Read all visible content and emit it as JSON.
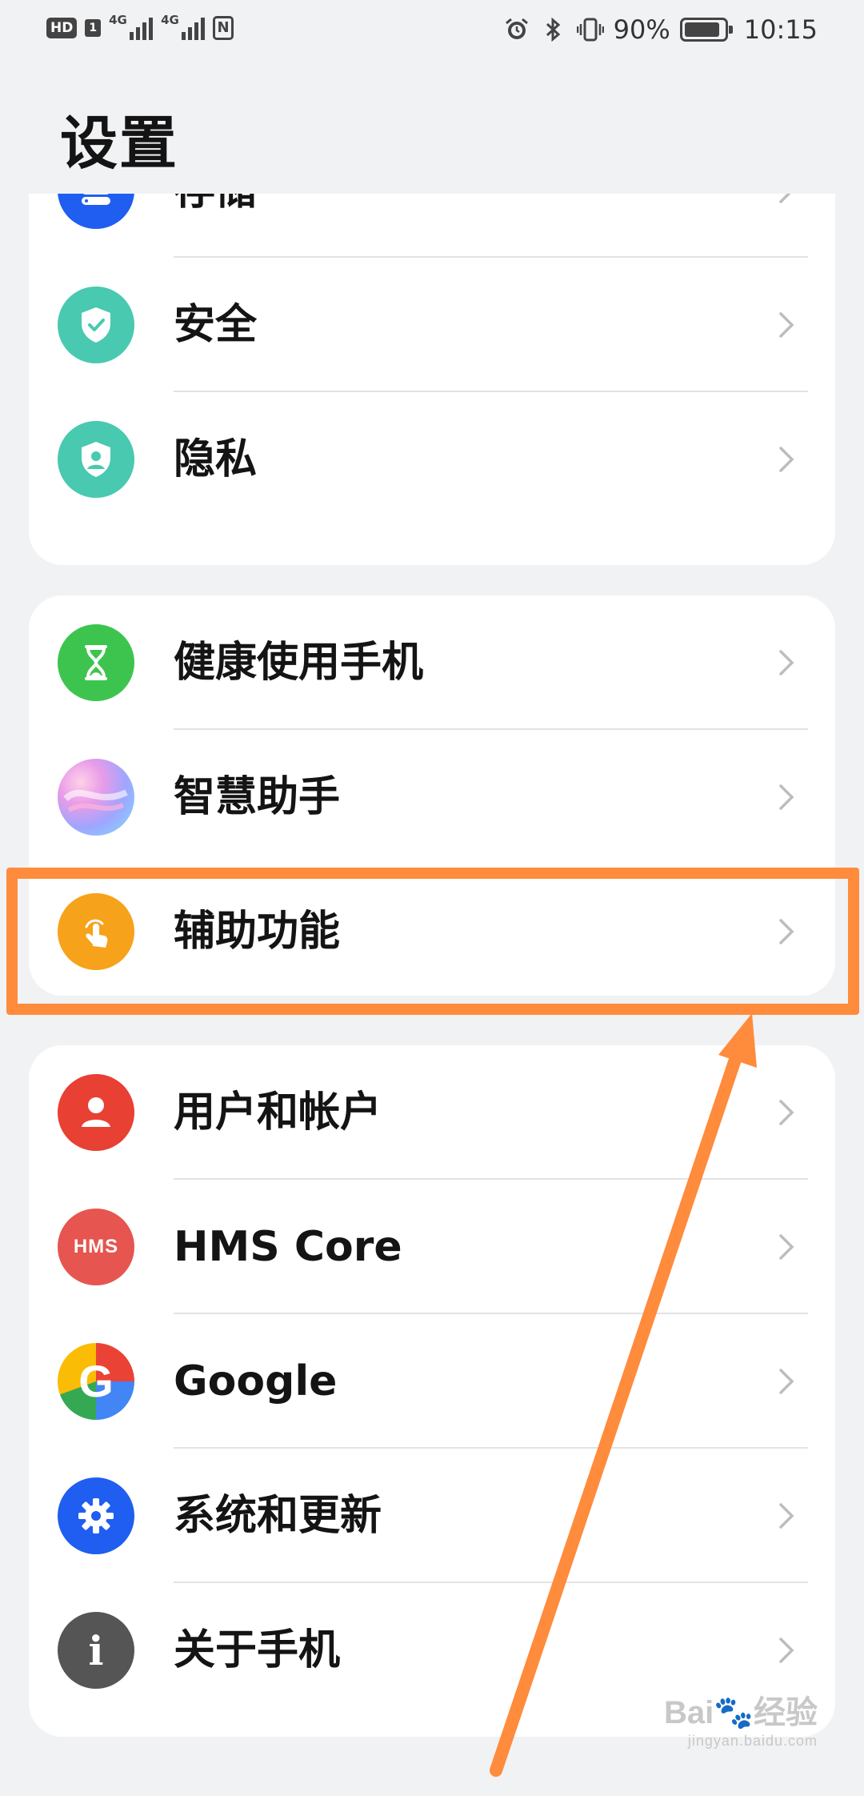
{
  "status_bar": {
    "hd_badge": "HD",
    "sim_badge": "1",
    "signal1_label": "4G",
    "signal2_label": "4G",
    "nfc": "N",
    "battery_percent": "90%",
    "battery_level": 0.9,
    "time": "10:15"
  },
  "page": {
    "title": "设置"
  },
  "groups": [
    {
      "items": [
        {
          "label": "存储",
          "icon": "storage-icon",
          "color": "#1f5ef0"
        },
        {
          "label": "安全",
          "icon": "security-shield-icon",
          "color": "#48c9b0"
        },
        {
          "label": "隐私",
          "icon": "privacy-shield-icon",
          "color": "#48c9b0"
        }
      ]
    },
    {
      "items": [
        {
          "label": "健康使用手机",
          "icon": "hourglass-icon",
          "color": "#3dc44f"
        },
        {
          "label": "智慧助手",
          "icon": "smart-assistant-icon",
          "color": "#9fa5ff"
        },
        {
          "label": "辅助功能",
          "icon": "accessibility-hand-icon",
          "color": "#f7a21b"
        }
      ]
    },
    {
      "items": [
        {
          "label": "用户和帐户",
          "icon": "user-icon",
          "color": "#e84033"
        },
        {
          "label": "HMS Core",
          "icon": "hms-icon",
          "icon_text": "HMS",
          "color": "#e65550"
        },
        {
          "label": "Google",
          "icon": "google-icon",
          "icon_text": "G",
          "color": "#ffffff"
        },
        {
          "label": "系统和更新",
          "icon": "gear-icon",
          "color": "#1f5ef0"
        },
        {
          "label": "关于手机",
          "icon": "info-icon",
          "icon_text": "i",
          "color": "#555555"
        }
      ]
    }
  ],
  "annotation": {
    "highlight_color": "#ff8b3c"
  },
  "watermark": {
    "brand": "Bai",
    "brand2": "经验",
    "site": "jingyan.baidu.com"
  }
}
